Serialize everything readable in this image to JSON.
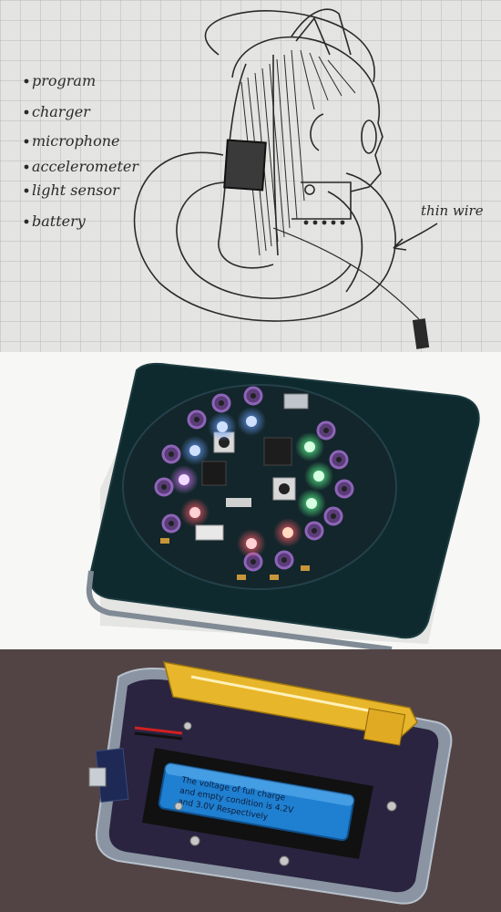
{
  "sketch": {
    "bullets": [
      "program",
      "charger",
      "microphone",
      "accelerometer",
      "light sensor",
      "battery"
    ],
    "arrow_label": "thin wire"
  },
  "board_photo": {
    "led_colors": [
      "#2b6bff",
      "#2b6bff",
      "#1fd35a",
      "#1fd35a",
      "#c040ff",
      "#ff2a3a",
      "#ff2a3a",
      "#ff6a3a",
      "#1fd35a",
      "#1fd35a"
    ]
  },
  "battery_photo": {
    "battery_lines": [
      "The voltage of full charge",
      "and empty condition is 4.2V",
      "and 3.0V Respectively"
    ],
    "colors": {
      "clip": "#e8b62a",
      "battery": "#1f7fd0",
      "board": "#2a2440"
    }
  }
}
